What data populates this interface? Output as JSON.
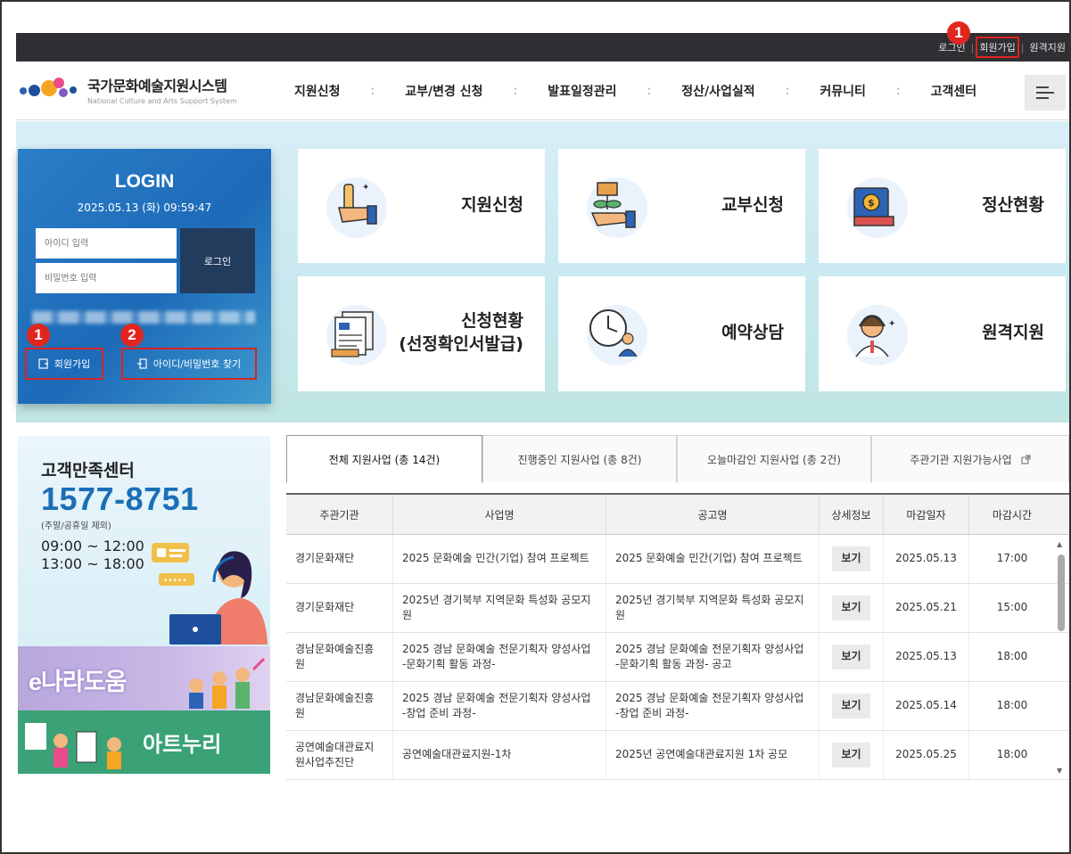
{
  "topbar": {
    "links": [
      "로그인",
      "회원가입",
      "원격지원"
    ]
  },
  "markers": {
    "one": "1",
    "two": "2"
  },
  "header": {
    "logo_title": "국가문화예술지원시스템",
    "logo_sub": "National Culture and Arts Support System",
    "menu": [
      "지원신청",
      "교부/변경 신청",
      "발표일정관리",
      "정산/사업실적",
      "커뮤니티",
      "고객센터"
    ],
    "menu_icon": "hamburger-icon"
  },
  "login": {
    "title": "LOGIN",
    "datetime": "2025.05.13 (화) 09:59:47",
    "id_placeholder": "아이디 입력",
    "pw_placeholder": "비밀번호 입력",
    "login_button": "로그인",
    "signup_button": "회원가입",
    "find_button": "아이디/비밀번호 찾기"
  },
  "tiles": [
    {
      "label": "지원신청",
      "icon": "hand-pen-icon"
    },
    {
      "label": "교부신청",
      "icon": "hand-plant-icon"
    },
    {
      "label": "정산현황",
      "icon": "book-coin-icon"
    },
    {
      "label_line1": "신청현황",
      "label_line2": "(선정확인서발급)",
      "icon": "document-icon"
    },
    {
      "label": "예약상담",
      "icon": "clock-person-icon"
    },
    {
      "label": "원격지원",
      "icon": "headset-person-icon"
    }
  ],
  "customer_center": {
    "title": "고객만족센터",
    "phone": "1577-8751",
    "note": "(주말/공휴일 제외)",
    "hours_am": "09:00 ~ 12:00",
    "hours_pm": "13:00 ~ 18:00"
  },
  "banners": {
    "enara": "e나라도움",
    "artnuri": "아트누리"
  },
  "tabs": [
    "전체 지원사업 (총 14건)",
    "진행중인 지원사업 (총 8건)",
    "오늘마감인 지원사업 (총 2건)",
    "주관기관 지원가능사업"
  ],
  "table": {
    "headers": [
      "주관기관",
      "사업명",
      "공고명",
      "상세정보",
      "마감일자",
      "마감시간"
    ],
    "rows": [
      {
        "org": "경기문화재단",
        "biz": "2025 문화예술 민간(기업) 참여 프로젝트",
        "notice": "2025 문화예술 민간(기업) 참여 프로젝트",
        "detail": "보기",
        "date": "2025.05.13",
        "time": "17:00"
      },
      {
        "org": "경기문화재단",
        "biz": "2025년 경기북부 지역문화 특성화 공모지원",
        "notice": "2025년 경기북부 지역문화 특성화 공모지원",
        "detail": "보기",
        "date": "2025.05.21",
        "time": "15:00"
      },
      {
        "org": "경남문화예술진흥원",
        "biz": "2025 경남 문화예술 전문기획자 양성사업 -문화기획 활동 과정-",
        "notice": "2025 경남 문화예술 전문기획자 양성사업 -문화기획 활동 과정- 공고",
        "detail": "보기",
        "date": "2025.05.13",
        "time": "18:00"
      },
      {
        "org": "경남문화예술진흥원",
        "biz": "2025 경남 문화예술 전문기획자 양성사업 -창업 준비 과정-",
        "notice": "2025 경남 문화예술 전문기획자 양성사업 -창업 준비 과정-",
        "detail": "보기",
        "date": "2025.05.14",
        "time": "18:00"
      },
      {
        "org": "공연예술대관료지원사업추진단",
        "biz": "공연예술대관료지원-1차",
        "notice": "2025년 공연예술대관료지원 1차 공모",
        "detail": "보기",
        "date": "2025.05.25",
        "time": "18:00"
      }
    ]
  },
  "colors": {
    "topbar": "#2f2f33",
    "accent_blue": "#1b6fb7",
    "highlight_red": "#e0261f"
  }
}
